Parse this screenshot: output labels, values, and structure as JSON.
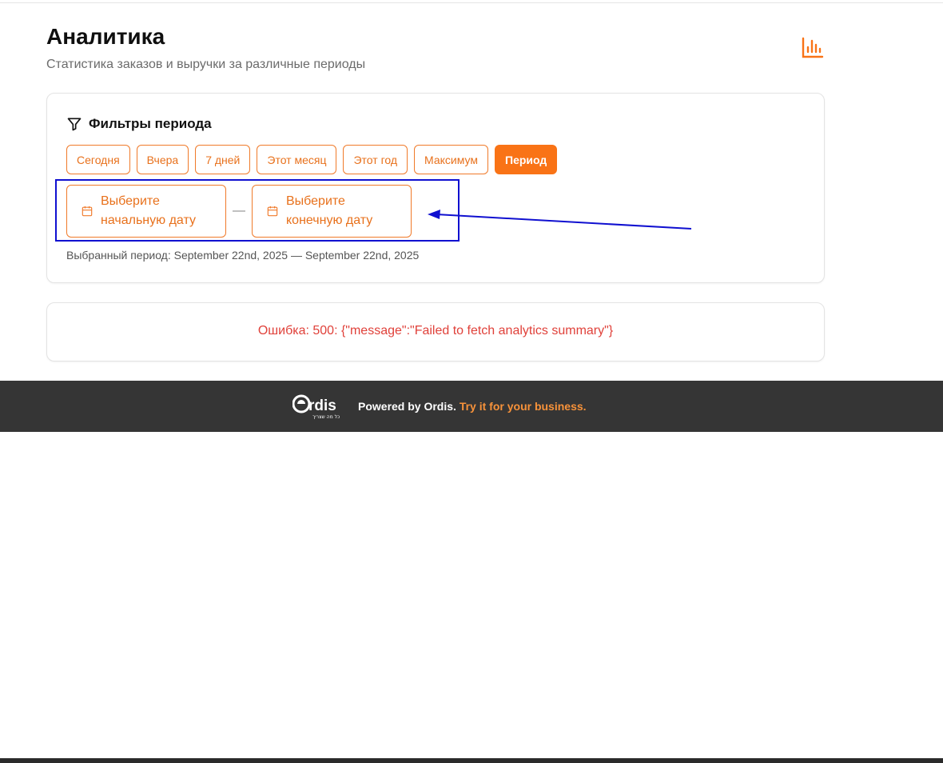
{
  "header": {
    "title": "Аналитика",
    "subtitle": "Статистика заказов и выручки за различные периоды",
    "icon": "bar-chart-icon"
  },
  "filters": {
    "title": "Фильтры периода",
    "icon": "filter-icon",
    "period_buttons": [
      "Сегодня",
      "Вчера",
      "7 дней",
      "Этот месяц",
      "Этот год",
      "Максимум",
      "Период"
    ],
    "active_button": "Период",
    "start_date_placeholder": "Выберите начальную дату",
    "end_date_placeholder": "Выберите конечную дату",
    "separator": "—",
    "selected_period": "Выбранный период: September 22nd, 2025 — September 22nd, 2025"
  },
  "error": {
    "message": "Ошибка: 500: {\"message\":\"Failed to fetch analytics summary\"}"
  },
  "footer": {
    "logo_text": "Ordis",
    "logo_tagline": "כל מה שצריך",
    "powered_text": "Powered by Ordis.",
    "link_text": "Try it for your business."
  },
  "colors": {
    "accent": "#f97316",
    "error": "#e0413a",
    "annotation": "#1010d0",
    "footer_bg": "#353535"
  }
}
